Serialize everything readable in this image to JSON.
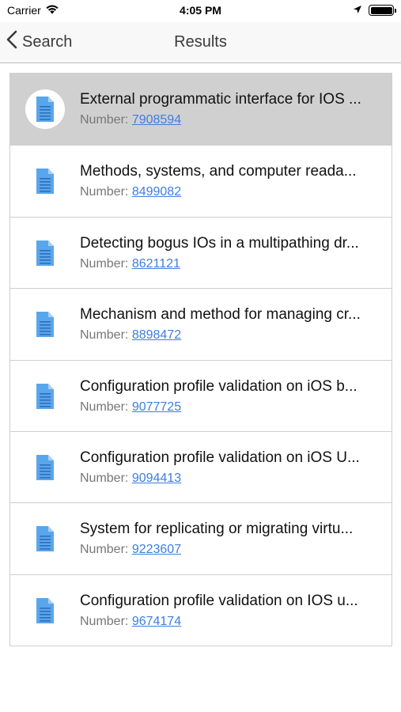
{
  "status_bar": {
    "carrier": "Carrier",
    "time": "4:05 PM"
  },
  "nav": {
    "back_label": "Search",
    "title": "Results"
  },
  "colors": {
    "doc_icon": "#5aa6ec",
    "link": "#3d7ee0",
    "selected_row": "#d0d0d0"
  },
  "results": [
    {
      "title": "External programmatic interface for IOS ...",
      "number_label": "Number:",
      "number": "7908594",
      "selected": true
    },
    {
      "title": "Methods, systems, and computer reada...",
      "number_label": "Number:",
      "number": "8499082"
    },
    {
      "title": "Detecting bogus IOs in a multipathing dr...",
      "number_label": "Number:",
      "number": "8621121"
    },
    {
      "title": "Mechanism and method for managing cr...",
      "number_label": "Number:",
      "number": "8898472"
    },
    {
      "title": "Configuration profile validation on iOS b...",
      "number_label": "Number:",
      "number": "9077725"
    },
    {
      "title": "Configuration profile validation on iOS U...",
      "number_label": "Number:",
      "number": "9094413"
    },
    {
      "title": "System for replicating or migrating virtu...",
      "number_label": "Number:",
      "number": "9223607"
    },
    {
      "title": "Configuration profile validation on IOS u...",
      "number_label": "Number:",
      "number": "9674174"
    }
  ]
}
